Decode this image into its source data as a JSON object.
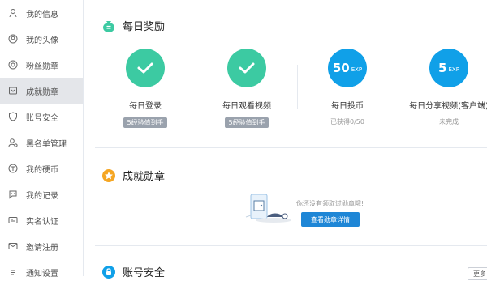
{
  "sidebar": {
    "items": [
      {
        "label": "我的信息",
        "icon": "user-icon"
      },
      {
        "label": "我的头像",
        "icon": "avatar-icon"
      },
      {
        "label": "粉丝勋章",
        "icon": "fan-medal-icon"
      },
      {
        "label": "成就勋章",
        "icon": "achievement-icon",
        "active": true
      },
      {
        "label": "账号安全",
        "icon": "shield-icon"
      },
      {
        "label": "黑名单管理",
        "icon": "blacklist-icon"
      },
      {
        "label": "我的硬币",
        "icon": "coin-icon"
      },
      {
        "label": "我的记录",
        "icon": "record-icon"
      },
      {
        "label": "实名认证",
        "icon": "id-card-icon"
      },
      {
        "label": "邀请注册",
        "icon": "invite-icon"
      },
      {
        "label": "通知设置",
        "icon": "notification-icon"
      }
    ]
  },
  "daily": {
    "title": "每日奖励",
    "tasks": [
      {
        "name": "每日登录",
        "badge": "5经验值到手",
        "done": true
      },
      {
        "name": "每日观看视频",
        "badge": "5经验值到手",
        "done": true
      },
      {
        "name": "每日投币",
        "exp": "50",
        "exp_unit": "EXP",
        "status": "已获得0/50"
      },
      {
        "name": "每日分享视频(客户端)",
        "exp": "5",
        "exp_unit": "EXP",
        "status": "未完成"
      }
    ]
  },
  "achievement": {
    "title": "成就勋章",
    "empty_text": "你还没有领取过勋章哦!",
    "button": "查看勋章详情"
  },
  "security": {
    "title": "账号安全",
    "more": "更多"
  },
  "colors": {
    "green": "#3ccaa2",
    "blue": "#10a0e8",
    "orange": "#f5a623",
    "button": "#1e86d6"
  }
}
